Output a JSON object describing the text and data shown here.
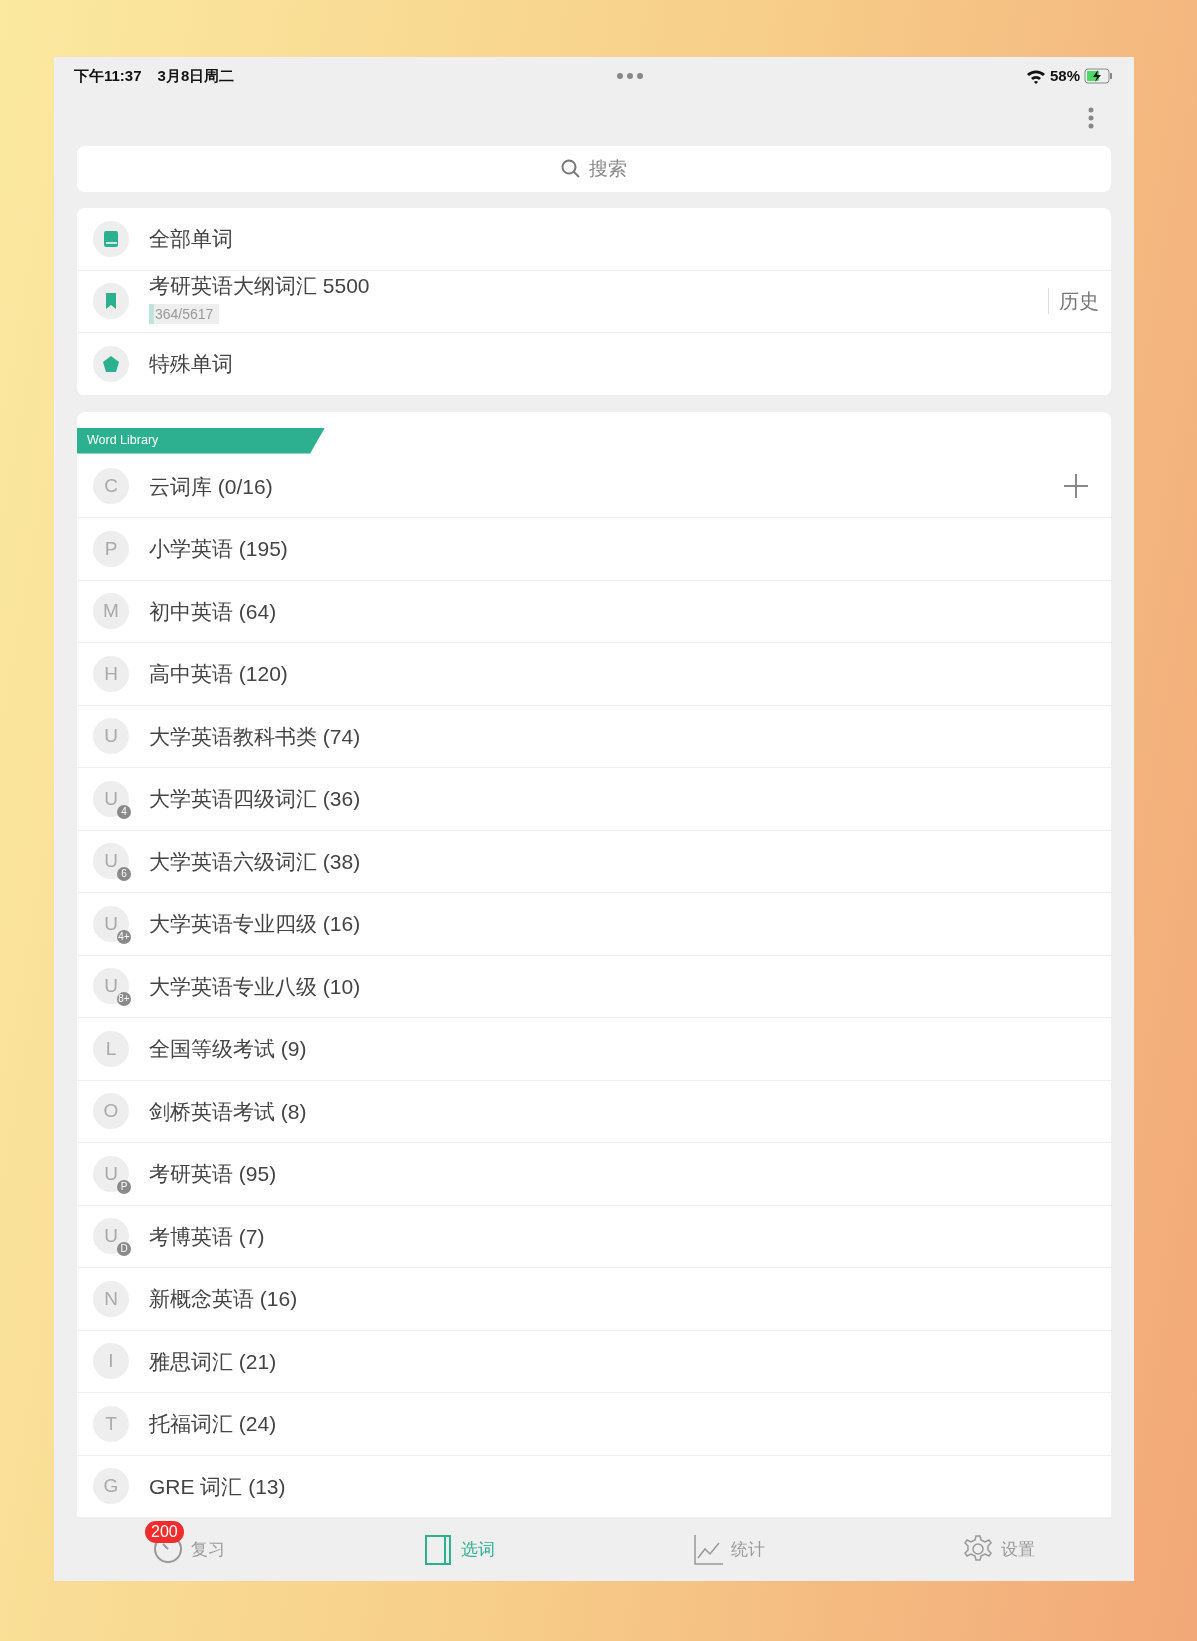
{
  "status_bar": {
    "time": "下午11:37",
    "date": "3月8日周二",
    "battery": "58%"
  },
  "search": {
    "placeholder": "搜索"
  },
  "top_list": [
    {
      "kind": "book",
      "label": "全部单词"
    },
    {
      "kind": "bookmark",
      "label": "考研英语大纲词汇 5500",
      "progress_text": "364/5617",
      "level": 0.065,
      "action": "历史"
    },
    {
      "kind": "pentagon",
      "label": "特殊单词"
    }
  ],
  "library": {
    "title": "Word Library",
    "items": [
      {
        "letter": "C",
        "label": "云词库 (0/16)",
        "add": true
      },
      {
        "letter": "P",
        "label": "小学英语 (195)"
      },
      {
        "letter": "M",
        "label": "初中英语 (64)"
      },
      {
        "letter": "H",
        "label": "高中英语 (120)"
      },
      {
        "letter": "U",
        "label": "大学英语教科书类 (74)"
      },
      {
        "letter": "U",
        "sub": "4",
        "label": "大学英语四级词汇 (36)"
      },
      {
        "letter": "U",
        "sub": "6",
        "label": "大学英语六级词汇 (38)"
      },
      {
        "letter": "U",
        "sub": "4+",
        "label": "大学英语专业四级 (16)"
      },
      {
        "letter": "U",
        "sub": "8+",
        "label": "大学英语专业八级 (10)"
      },
      {
        "letter": "L",
        "label": "全国等级考试 (9)"
      },
      {
        "letter": "O",
        "label": "剑桥英语考试 (8)"
      },
      {
        "letter": "U",
        "sub": "P",
        "label": "考研英语 (95)"
      },
      {
        "letter": "U",
        "sub": "D",
        "label": "考博英语 (7)"
      },
      {
        "letter": "N",
        "label": "新概念英语 (16)"
      },
      {
        "letter": "I",
        "label": "雅思词汇 (21)"
      },
      {
        "letter": "T",
        "label": "托福词汇 (24)"
      },
      {
        "letter": "G",
        "label": "GRE 词汇 (13)"
      }
    ]
  },
  "tabs": [
    {
      "kind": "review",
      "label": "复习",
      "badge": "200",
      "selected": false
    },
    {
      "kind": "select",
      "label": "选词",
      "selected": true
    },
    {
      "kind": "stats",
      "label": "统计",
      "selected": false
    },
    {
      "kind": "settings",
      "label": "设置",
      "selected": false
    }
  ]
}
